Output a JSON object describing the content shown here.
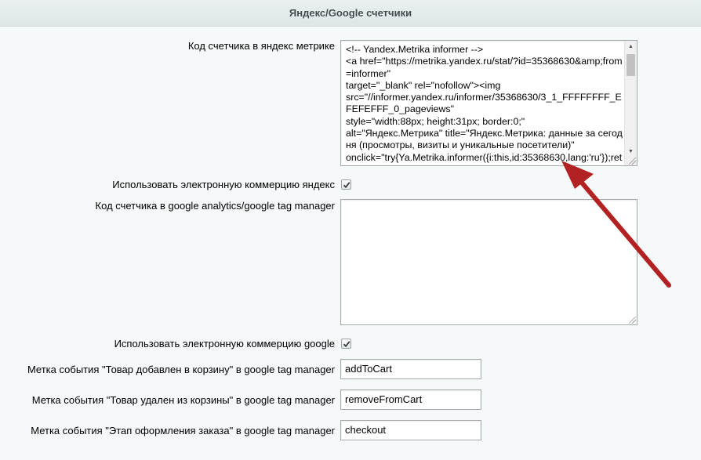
{
  "section": {
    "title": "Яндекс/Google счетчики"
  },
  "fields": {
    "yandex_code": {
      "label": "Код счетчика в яндекс метрике",
      "value": "<!-- Yandex.Metrika informer -->\n<a href=\"https://metrika.yandex.ru/stat/?id=35368630&amp;from=informer\"\ntarget=\"_blank\" rel=\"nofollow\"><img\nsrc=\"//informer.yandex.ru/informer/35368630/3_1_FFFFFFFF_EFEFEFFF_0_pageviews\"\nstyle=\"width:88px; height:31px; border:0;\"\nalt=\"Яндекс.Метрика\" title=\"Яндекс.Метрика: данные за сегодня (просмотры, визиты и уникальные посетители)\"\nonclick=\"try{Ya.Metrika.informer({i:this,id:35368630,lang:'ru'});return false}catch(e){}\"/></a>"
    },
    "yandex_ecommerce": {
      "label": "Использовать электронную коммерцию яндекс",
      "checked": true
    },
    "google_code": {
      "label": "Код счетчика в google analytics/google tag manager",
      "value": ""
    },
    "google_ecommerce": {
      "label": "Использовать электронную коммерцию google",
      "checked": true
    },
    "add_to_cart": {
      "label": "Метка события \"Товар добавлен в корзину\" в google tag manager",
      "value": "addToCart"
    },
    "remove_from_cart": {
      "label": "Метка события \"Товар удален из корзины\" в google tag manager",
      "value": "removeFromCart"
    },
    "checkout": {
      "label": "Метка события \"Этап оформления заказа\" в google tag manager",
      "value": "checkout"
    }
  },
  "colors": {
    "annotation_arrow": "#b22222",
    "background": "#f5f9f9"
  }
}
